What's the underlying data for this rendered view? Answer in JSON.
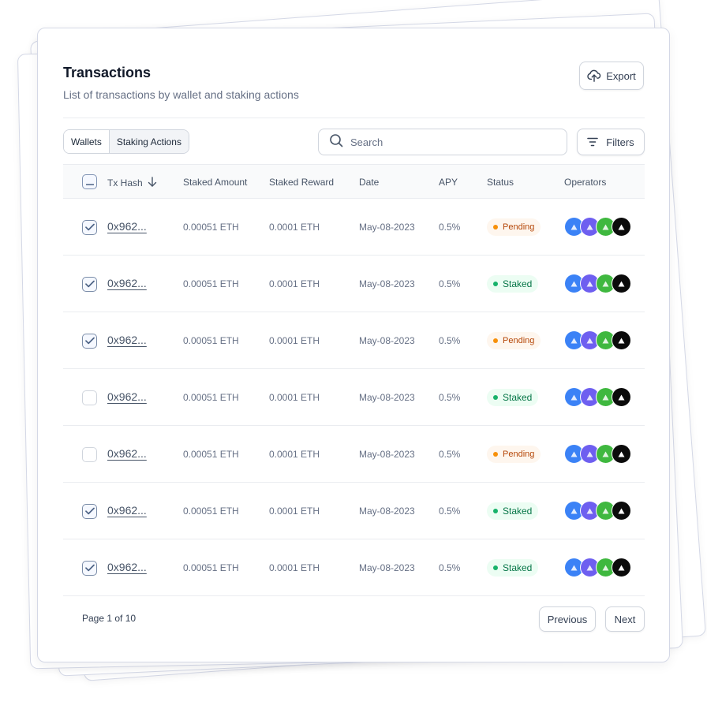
{
  "header": {
    "title": "Transactions",
    "subtitle": "List of transactions by wallet and staking actions",
    "export_label": "Export"
  },
  "toolbar": {
    "segments": [
      {
        "label": "Wallets",
        "active": false
      },
      {
        "label": "Staking Actions",
        "active": true
      }
    ],
    "search_placeholder": "Search",
    "filters_label": "Filters"
  },
  "table": {
    "columns": [
      "Tx Hash",
      "Staked Amount",
      "Staked Reward",
      "Date",
      "APY",
      "Status",
      "Operators"
    ],
    "header_checkbox": "indeterminate",
    "rows": [
      {
        "checked": true,
        "hash": "0x962...",
        "amount": "0.00051 ETH",
        "reward": "0.0001 ETH",
        "date": "May-08-2023",
        "apy": "0.5%",
        "status": "Pending"
      },
      {
        "checked": true,
        "hash": "0x962...",
        "amount": "0.00051 ETH",
        "reward": "0.0001 ETH",
        "date": "May-08-2023",
        "apy": "0.5%",
        "status": "Staked"
      },
      {
        "checked": true,
        "hash": "0x962...",
        "amount": "0.00051 ETH",
        "reward": "0.0001 ETH",
        "date": "May-08-2023",
        "apy": "0.5%",
        "status": "Pending"
      },
      {
        "checked": false,
        "hash": "0x962...",
        "amount": "0.00051 ETH",
        "reward": "0.0001 ETH",
        "date": "May-08-2023",
        "apy": "0.5%",
        "status": "Staked"
      },
      {
        "checked": false,
        "hash": "0x962...",
        "amount": "0.00051 ETH",
        "reward": "0.0001 ETH",
        "date": "May-08-2023",
        "apy": "0.5%",
        "status": "Pending"
      },
      {
        "checked": true,
        "hash": "0x962...",
        "amount": "0.00051 ETH",
        "reward": "0.0001 ETH",
        "date": "May-08-2023",
        "apy": "0.5%",
        "status": "Staked"
      },
      {
        "checked": true,
        "hash": "0x962...",
        "amount": "0.00051 ETH",
        "reward": "0.0001 ETH",
        "date": "May-08-2023",
        "apy": "0.5%",
        "status": "Staked"
      }
    ],
    "operators": [
      {
        "icon": "operator-avatar-blue",
        "color": "#3b82f6"
      },
      {
        "icon": "operator-avatar-purple",
        "color": "#6e5ff0"
      },
      {
        "icon": "operator-avatar-green",
        "color": "#3fb83f"
      },
      {
        "icon": "operator-avatar-black",
        "color": "#0b0b0b"
      }
    ]
  },
  "status_colors": {
    "Pending": {
      "dot": "#f79009"
    },
    "Staked": {
      "dot": "#17b26a"
    }
  },
  "pagination": {
    "page_info": "Page 1 of 10",
    "previous_label": "Previous",
    "next_label": "Next"
  },
  "icons": {
    "export": "cloud-upload-icon",
    "filters": "filter-lines-icon",
    "search": "search-icon",
    "sort": "arrow-down-icon",
    "check": "check-icon",
    "minus": "minus-icon"
  }
}
